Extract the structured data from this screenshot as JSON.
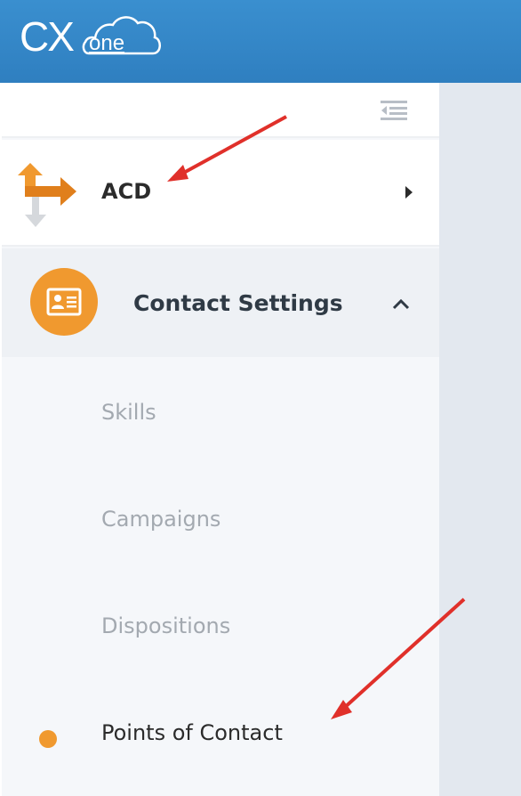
{
  "header": {
    "logo_cx": "CX",
    "logo_one": "one",
    "brand_color": "#3a8fcf"
  },
  "sidebar": {
    "collapse_icon": "collapse-menu-icon",
    "acd": {
      "label": "ACD",
      "icon": "acd-arrows-icon",
      "chevron": "chevron-right-icon"
    },
    "contact_settings": {
      "label": "Contact Settings",
      "icon": "contact-card-icon",
      "chevron": "chevron-up-icon",
      "expanded": true,
      "items": [
        {
          "label": "Skills",
          "active": false
        },
        {
          "label": "Campaigns",
          "active": false
        },
        {
          "label": "Dispositions",
          "active": false
        },
        {
          "label": "Points of Contact",
          "active": true
        }
      ]
    },
    "accent_color": "#f0992f"
  },
  "annotations": {
    "arrow_color": "#e0302a"
  }
}
